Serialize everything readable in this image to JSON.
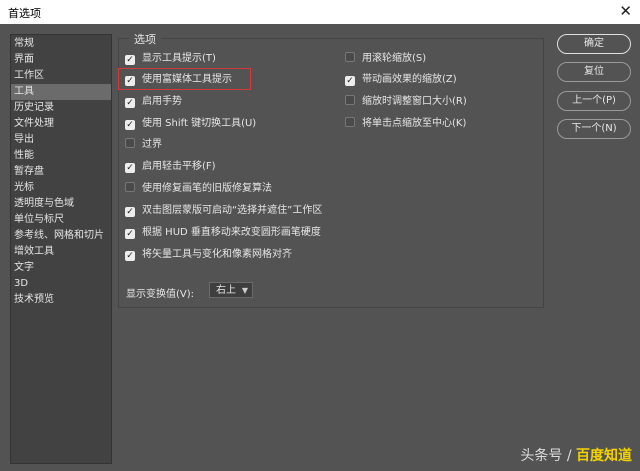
{
  "window": {
    "title": "首选项",
    "close_icon": "close-icon"
  },
  "sidebar": {
    "items": [
      {
        "label": "常规",
        "selected": false
      },
      {
        "label": "界面",
        "selected": false
      },
      {
        "label": "工作区",
        "selected": false
      },
      {
        "label": "工具",
        "selected": true
      },
      {
        "label": "历史记录",
        "selected": false
      },
      {
        "label": "文件处理",
        "selected": false
      },
      {
        "label": "导出",
        "selected": false
      },
      {
        "label": "性能",
        "selected": false
      },
      {
        "label": "暂存盘",
        "selected": false
      },
      {
        "label": "光标",
        "selected": false
      },
      {
        "label": "透明度与色域",
        "selected": false
      },
      {
        "label": "单位与标尺",
        "selected": false
      },
      {
        "label": "参考线、网格和切片",
        "selected": false
      },
      {
        "label": "增效工具",
        "selected": false
      },
      {
        "label": "文字",
        "selected": false
      },
      {
        "label": "3D",
        "selected": false
      },
      {
        "label": "技术预览",
        "selected": false
      }
    ]
  },
  "options": {
    "group_title": "选项",
    "left": [
      {
        "label": "显示工具提示(T)",
        "checked": true
      },
      {
        "label": "使用富媒体工具提示",
        "checked": true
      },
      {
        "label": "启用手势",
        "checked": true
      },
      {
        "label": "使用 Shift 键切换工具(U)",
        "checked": true
      },
      {
        "label": "过界",
        "checked": false
      },
      {
        "label": "启用轻击平移(F)",
        "checked": true
      },
      {
        "label": "使用修复画笔的旧版修复算法",
        "checked": false
      },
      {
        "label": "双击图层蒙版可启动“选择并遮住”工作区",
        "checked": true
      },
      {
        "label": "根据 HUD 垂直移动来改变圆形画笔硬度",
        "checked": true
      },
      {
        "label": "将矢量工具与变化和像素网格对齐",
        "checked": true
      }
    ],
    "right": [
      {
        "label": "用滚轮缩放(S)",
        "checked": false
      },
      {
        "label": "带动画效果的缩放(Z)",
        "checked": true
      },
      {
        "label": "缩放时调整窗口大小(R)",
        "checked": false
      },
      {
        "label": "将单击点缩放至中心(K)",
        "checked": false
      }
    ],
    "transform_values": {
      "label": "显示变换值(V):",
      "selected": "右上"
    }
  },
  "buttons": {
    "ok": "确定",
    "reset": "复位",
    "prev": "上一个(P)",
    "next": "下一个(N)"
  },
  "watermark": {
    "part1": "头条号 / ",
    "part2": "百度知道"
  },
  "colors": {
    "highlight_border": "#d33a3a",
    "watermark_accent": "#f3d200"
  }
}
